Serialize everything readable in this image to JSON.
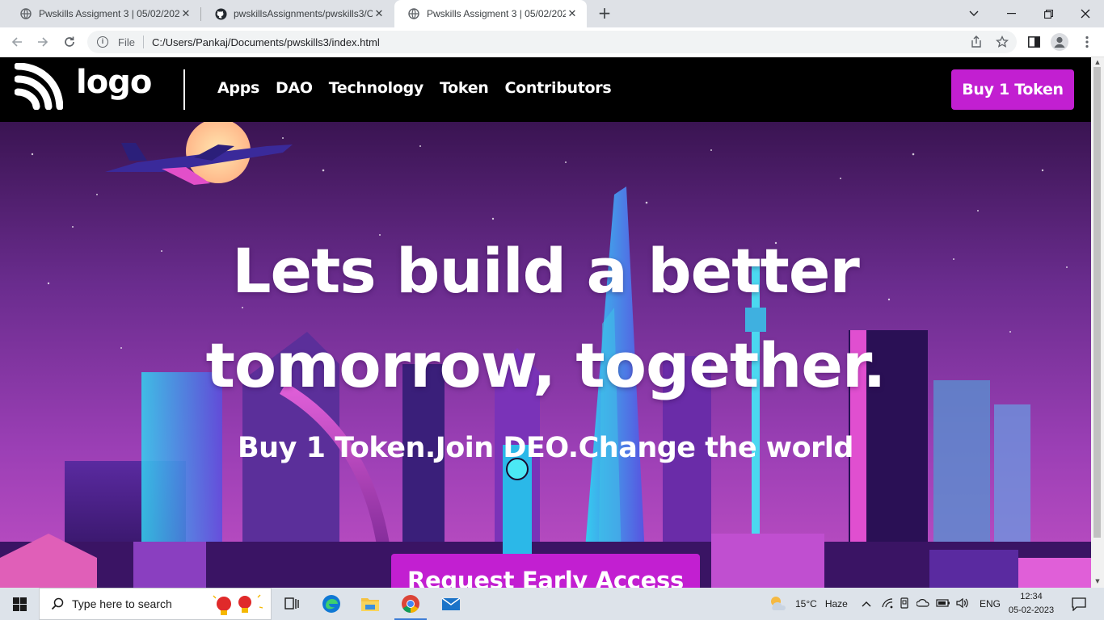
{
  "browser": {
    "tabs": [
      {
        "title": "Pwskills Assigment 3 | 05/02/202",
        "favicon": "globe-icon",
        "active": false
      },
      {
        "title": "pwskillsAssignments/pwskills3/O",
        "favicon": "github-icon",
        "active": false
      },
      {
        "title": "Pwskills Assigment 3 | 05/02/202",
        "favicon": "globe-icon",
        "active": true
      }
    ],
    "new_tab": "+",
    "address": {
      "scheme_label": "File",
      "url": "C:/Users/Pankaj/Documents/pwskills3/index.html"
    }
  },
  "site": {
    "logo_text": "logo",
    "nav": [
      "Apps",
      "DAO",
      "Technology",
      "Token",
      "Contributors"
    ],
    "buy_button": "Buy 1 Token",
    "headline_line1": "Lets build a better",
    "headline_line2": "tomorrow, together.",
    "subheadline": "Buy 1 Token.Join DEO.Change the world",
    "cta": "Request Early Access"
  },
  "taskbar": {
    "search_placeholder": "Type here to search",
    "weather_temp": "15°C",
    "weather_desc": "Haze",
    "language": "ENG",
    "time": "12:34",
    "date": "05-02-2023"
  },
  "colors": {
    "accent": "#c21fd1",
    "nav_bg": "#000000"
  }
}
